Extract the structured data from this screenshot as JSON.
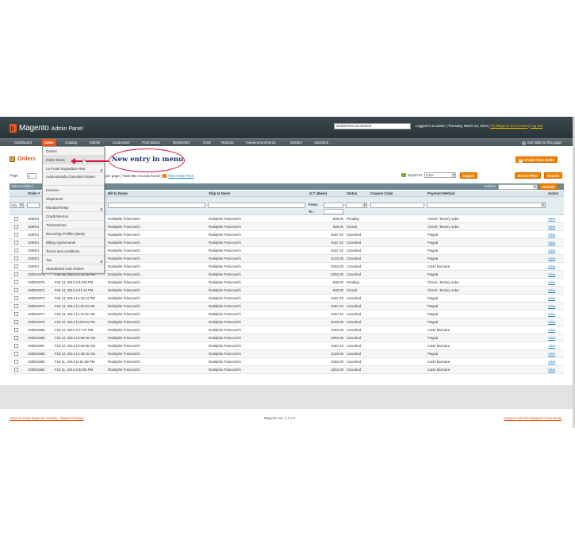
{
  "header": {
    "logo_text": "Magento",
    "logo_sub": "Admin Panel",
    "global_search_value": "Global Record Search",
    "logged_in": "Logged in as admin  |  Thursday, March 13, 2014  |",
    "try_link": "Try Magento Go for Free",
    "sep": "|",
    "logout": "Log Out"
  },
  "nav": {
    "items": [
      "Dashboard",
      "Sales",
      "Catalog",
      "Mobile",
      "Customers",
      "Promotions",
      "Newsletter",
      "CMS",
      "Reports",
      "meeta-ecommerce",
      "System",
      "Abo/Sips"
    ],
    "help": "Get help for this page"
  },
  "menu": {
    "items": [
      "Orders",
      "Order Items",
      "La Poste Expedition Rwt",
      "Automatically Canceled Orders",
      "Invoices",
      "Shipments",
      "Mondial Relay",
      "Credit Memos",
      "Transactions",
      "Recurring Profiles (beta)",
      "Billing Agreements",
      "Terms and conditions",
      "Tax",
      "Abandoned Cart Orders"
    ]
  },
  "annotation": {
    "text": "New entry in menu"
  },
  "page": {
    "title": "Orders",
    "create_button": "Create New Order",
    "plus": "+"
  },
  "toolbar": {
    "page_label": "Page",
    "page_value": "1",
    "perpage_text": "per page  |  Total 664 records found  |",
    "rss": "New Order RSS",
    "export_label": "Export to:",
    "export_value": "CSV",
    "export_button": "Export",
    "reset_button": "Reset Filter",
    "search_button": "Search",
    "select_visible": "Select Visible  |",
    "actions_label": "Actions",
    "submit_button": "Submit"
  },
  "grid": {
    "headers": {
      "order": "Order #",
      "bill_to": "Bill to Name",
      "ship_to": "Ship to Name",
      "gt": "G.T. (Base)",
      "status": "Status",
      "coupon": "Coupon Code",
      "payment": "Payment Method",
      "action": "Action"
    },
    "filter": {
      "any": "Any",
      "from": "From:",
      "to": "To :"
    },
    "rows": [
      {
        "order": "100001",
        "date": "",
        "bill": "Rodolphe Franceschi",
        "ship": "Rodolphe Franceschi",
        "gt": "€36.00",
        "status": "Pending",
        "payment": "Check / Money order",
        "action": "View"
      },
      {
        "order": "100001",
        "date": "",
        "bill": "Rodolphe Franceschi",
        "ship": "Rodolphe Franceschi",
        "gt": "€36.00",
        "status": "Closed",
        "payment": "Check / Money order",
        "action": "View"
      },
      {
        "order": "100001",
        "date": "",
        "bill": "Rodolphe Franceschi",
        "ship": "Rodolphe Franceschi",
        "gt": "€187.10",
        "status": "Canceled",
        "payment": "Paypal",
        "action": "View"
      },
      {
        "order": "100001",
        "date": "",
        "bill": "Rodolphe Franceschi",
        "ship": "Rodolphe Franceschi",
        "gt": "€187.10",
        "status": "Canceled",
        "payment": "Paypal",
        "action": "View"
      },
      {
        "order": "100001",
        "date": "",
        "bill": "Rodolphe Franceschi",
        "ship": "Rodolphe Franceschi",
        "gt": "€187.10",
        "status": "Canceled",
        "payment": "Paypal",
        "action": "View"
      },
      {
        "order": "100001",
        "date": "",
        "bill": "Rodolphe Franceschi",
        "ship": "Rodolphe Franceschi",
        "gt": "€133.00",
        "status": "Canceled",
        "payment": "Paypal",
        "action": "View"
      },
      {
        "order": "100001",
        "date": "",
        "bill": "Rodolphe Franceschi",
        "ship": "Rodolphe Franceschi",
        "gt": "€153.00",
        "status": "Canceled",
        "payment": "Carte bancaire",
        "action": "View"
      },
      {
        "order": "100001576",
        "date": "Feb 16, 2014 12:31:50 PM",
        "bill": "Rodolphe Franceschi",
        "ship": "Rodolphe Franceschi",
        "gt": "€254.00",
        "status": "Canceled",
        "payment": "Paypal",
        "action": "View"
      },
      {
        "order": "100001575",
        "date": "Feb 13, 2014 6:44:40 PM",
        "bill": "Rodolphe Franceschi",
        "ship": "Rodolphe Franceschi",
        "gt": "€36.00",
        "status": "Pending",
        "payment": "Check / Money order",
        "action": "View"
      },
      {
        "order": "100001574",
        "date": "Feb 13, 2014 5:41:16 PM",
        "bill": "Rodolphe Franceschi",
        "ship": "Rodolphe Franceschi",
        "gt": "€36.00",
        "status": "Closed",
        "payment": "Check / Money order",
        "action": "View"
      },
      {
        "order": "100001573",
        "date": "Feb 13, 2014 12:18:13 PM",
        "bill": "Rodolphe Franceschi",
        "ship": "Rodolphe Franceschi",
        "gt": "€187.10",
        "status": "Canceled",
        "payment": "Paypal",
        "action": "View"
      },
      {
        "order": "100001572",
        "date": "Feb 13, 2014 11:40:24 AM",
        "bill": "Rodolphe Franceschi",
        "ship": "Rodolphe Franceschi",
        "gt": "€187.10",
        "status": "Canceled",
        "payment": "Paypal",
        "action": "View"
      },
      {
        "order": "100001571",
        "date": "Feb 13, 2014 11:12:02 AM",
        "bill": "Rodolphe Franceschi",
        "ship": "Rodolphe Franceschi",
        "gt": "€187.10",
        "status": "Canceled",
        "payment": "Paypal",
        "action": "View"
      },
      {
        "order": "100001570",
        "date": "Feb 12, 2014 11:50:54 PM",
        "bill": "Rodolphe Franceschi",
        "ship": "Rodolphe Franceschi",
        "gt": "€133.00",
        "status": "Canceled",
        "payment": "Paypal",
        "action": "View"
      },
      {
        "order": "100001569",
        "date": "Feb 12, 2014 3:17:37 PM",
        "bill": "Rodolphe Franceschi",
        "ship": "Rodolphe Franceschi",
        "gt": "€153.00",
        "status": "Canceled",
        "payment": "Carte bancaire",
        "action": "View"
      },
      {
        "order": "100001568",
        "date": "Feb 12, 2014 10:59:05 AM",
        "bill": "Rodolphe Franceschi",
        "ship": "Rodolphe Franceschi",
        "gt": "€254.00",
        "status": "Canceled",
        "payment": "Paypal",
        "action": "View"
      },
      {
        "order": "100001567",
        "date": "Feb 12, 2014 10:50:05 AM",
        "bill": "Rodolphe Franceschi",
        "ship": "Rodolphe Franceschi",
        "gt": "€187.10",
        "status": "Canceled",
        "payment": "Carte bancaire",
        "action": "View"
      },
      {
        "order": "100001566",
        "date": "Feb 12, 2014 12:45:15 AM",
        "bill": "Rodolphe Franceschi",
        "ship": "Rodolphe Franceschi",
        "gt": "€133.00",
        "status": "Canceled",
        "payment": "Paypal",
        "action": "View"
      },
      {
        "order": "100001565",
        "date": "Feb 11, 2014 11:51:58 PM",
        "bill": "Rodolphe Franceschi",
        "ship": "Rodolphe Franceschi",
        "gt": "€153.00",
        "status": "Canceled",
        "payment": "Carte bancaire",
        "action": "View"
      },
      {
        "order": "100001564",
        "date": "Feb 11, 2014 9:33:06 PM",
        "bill": "Rodolphe Franceschi",
        "ship": "Rodolphe Franceschi",
        "gt": "€254.00",
        "status": "Canceled",
        "payment": "Carte bancaire",
        "action": "View"
      }
    ]
  },
  "footer": {
    "left": "Help Us Keep Magento Healthy - Report All Bugs",
    "center": "Magento ver. 1.7.0.2",
    "right": "Connect with the Magento Community"
  },
  "colors": {
    "accent": "#e8571e",
    "button": "#f18200",
    "header": "#2a3438",
    "annotation": "#d9103e"
  }
}
